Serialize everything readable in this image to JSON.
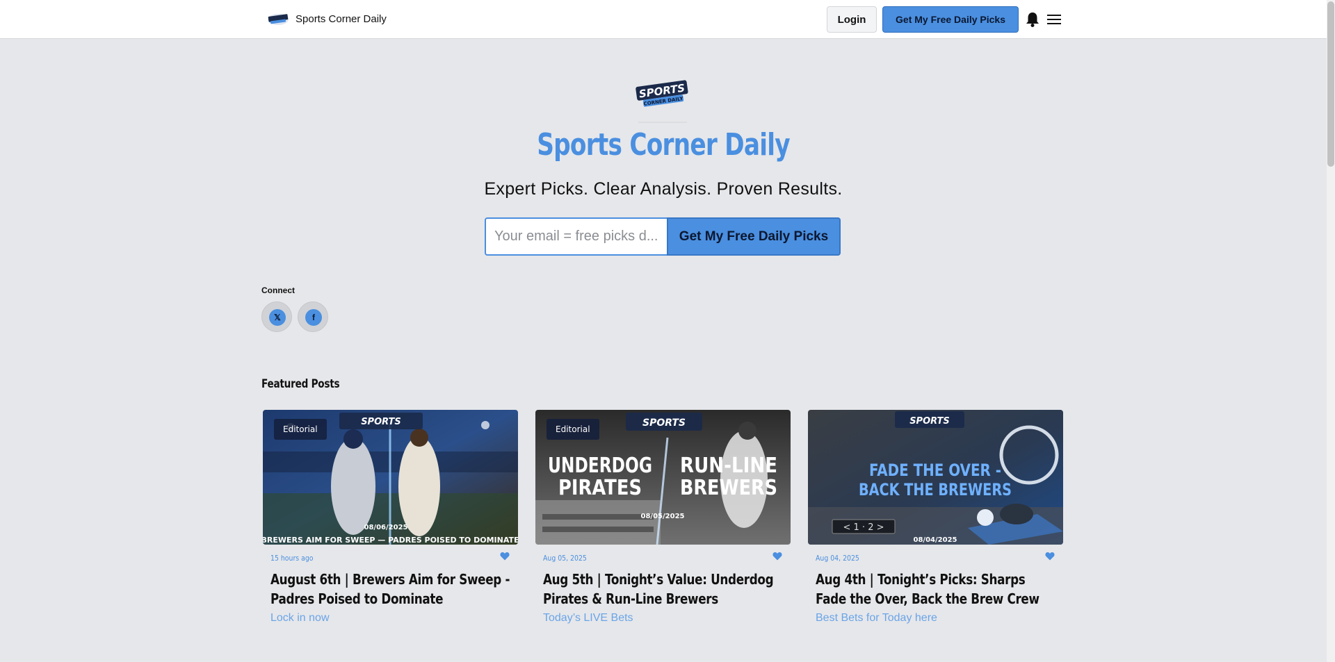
{
  "header": {
    "brand_name": "Sports Corner Daily",
    "login_label": "Login",
    "cta_label": "Get My Free Daily Picks"
  },
  "hero": {
    "title": "Sports Corner Daily",
    "tagline": "Expert Picks. Clear Analysis. Proven Results.",
    "email_placeholder": "Your email = free picks d...",
    "signup_label": "Get My Free Daily Picks",
    "logo_text": "SPORTS",
    "logo_subtext": "CORNER DAILY"
  },
  "connect": {
    "label": "Connect",
    "links": [
      {
        "icon": "x-icon",
        "glyph": "𝕏"
      },
      {
        "icon": "facebook-icon",
        "glyph": "f"
      }
    ]
  },
  "featured": {
    "label": "Featured Posts",
    "posts": [
      {
        "badge": "Editorial",
        "date": "15 hours ago",
        "title": "August 6th | Brewers Aim for Sweep - Padres Poised to Dominate",
        "cta": "Lock in now",
        "thumb_date": "08/06/2025",
        "thumb_caption": "“BREWERS AIM FOR SWEEP — PADRES POISED TO DOMINATE”"
      },
      {
        "badge": "Editorial",
        "date": "Aug 05, 2025",
        "title": "Aug 5th | Tonight’s Value: Underdog Pirates & Run-Line Brewers",
        "cta": "Today’s LIVE Bets",
        "thumb_date": "08/05/2025",
        "thumb_left": [
          "UNDERDOG",
          "PIRATES"
        ],
        "thumb_right": [
          "RUN-LINE",
          "BREWERS"
        ]
      },
      {
        "date": "Aug 04, 2025",
        "title": "Aug 4th | Tonight’s Picks: Sharps Fade the Over, Back the Brew Crew",
        "cta": "Best Bets for Today here",
        "thumb_date": "08/04/2025",
        "thumb_lines": [
          "FADE THE OVER -",
          "BACK THE BREWERS"
        ],
        "thumb_score": "< 1 · 2 >"
      }
    ]
  },
  "colors": {
    "accent": "#4a8fe0",
    "background": "#e6e7ea"
  }
}
